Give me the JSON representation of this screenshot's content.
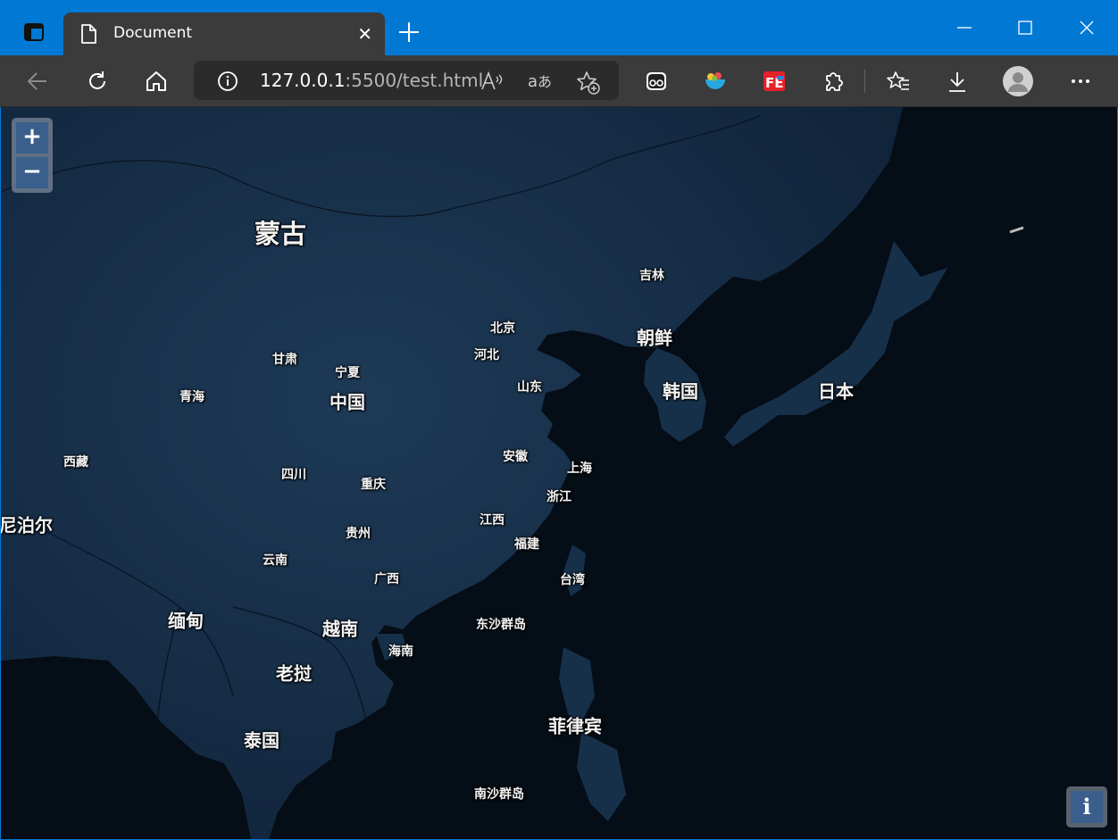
{
  "tab": {
    "title": "Document"
  },
  "address": {
    "host": "127.0.0.1",
    "rest": ":5500/test.html"
  },
  "zoom": {
    "in": "+",
    "out": "−"
  },
  "info": "i",
  "map_labels": [
    {
      "text": "蒙古",
      "size": "big"
    },
    {
      "text": "吉林",
      "size": "small"
    },
    {
      "text": "北京",
      "size": "small"
    },
    {
      "text": "朝鲜",
      "size": "mid"
    },
    {
      "text": "河北",
      "size": "small"
    },
    {
      "text": "甘肃",
      "size": "small"
    },
    {
      "text": "宁夏",
      "size": "small"
    },
    {
      "text": "山东",
      "size": "small"
    },
    {
      "text": "韩国",
      "size": "mid"
    },
    {
      "text": "日本",
      "size": "mid"
    },
    {
      "text": "青海",
      "size": "small"
    },
    {
      "text": "中国",
      "size": "mid"
    },
    {
      "text": "西藏",
      "size": "small"
    },
    {
      "text": "安徽",
      "size": "small"
    },
    {
      "text": "上海",
      "size": "small"
    },
    {
      "text": "四川",
      "size": "small"
    },
    {
      "text": "重庆",
      "size": "small"
    },
    {
      "text": "浙江",
      "size": "small"
    },
    {
      "text": "尼泊尔",
      "size": "mid"
    },
    {
      "text": "江西",
      "size": "small"
    },
    {
      "text": "贵州",
      "size": "small"
    },
    {
      "text": "福建",
      "size": "small"
    },
    {
      "text": "云南",
      "size": "small"
    },
    {
      "text": "广西",
      "size": "small"
    },
    {
      "text": "台湾",
      "size": "small"
    },
    {
      "text": "缅甸",
      "size": "mid"
    },
    {
      "text": "越南",
      "size": "mid"
    },
    {
      "text": "东沙群岛",
      "size": "small"
    },
    {
      "text": "海南",
      "size": "small"
    },
    {
      "text": "老挝",
      "size": "mid"
    },
    {
      "text": "菲律宾",
      "size": "mid"
    },
    {
      "text": "泰国",
      "size": "mid"
    },
    {
      "text": "南沙群岛",
      "size": "small"
    }
  ]
}
